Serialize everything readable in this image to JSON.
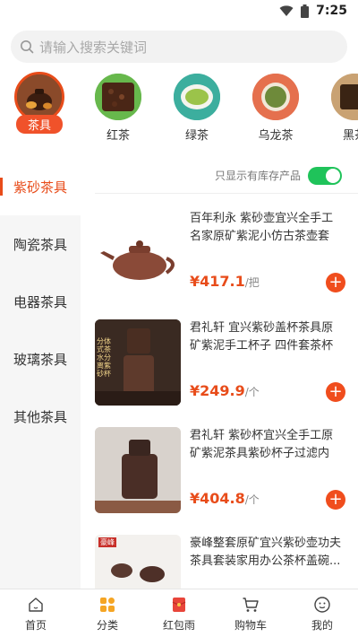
{
  "status_bar": {
    "time": "7:25"
  },
  "search": {
    "placeholder": "请输入搜索关键词"
  },
  "categories": [
    {
      "label": "茶具",
      "active": true
    },
    {
      "label": "红茶"
    },
    {
      "label": "绿茶"
    },
    {
      "label": "乌龙茶"
    },
    {
      "label": "黑茶"
    }
  ],
  "side_menu": [
    "紫砂茶具",
    "陶瓷茶具",
    "电器茶具",
    "玻璃茶具",
    "其他茶具"
  ],
  "stock_filter": {
    "label": "只显示有库存产品",
    "enabled": true
  },
  "products": [
    {
      "title": "百年利永 紫砂壶宜兴全手工名家原矿紫泥小仿古茶壶套装...",
      "price": "¥417.1",
      "unit": "/把",
      "img_text": ""
    },
    {
      "title": "君礼轩 宜兴紫砂盖杯茶具原矿紫泥手工杯子 四件套茶杯过...",
      "price": "¥249.9",
      "unit": "/个",
      "img_text": "分体式茶水分离紫砂杯"
    },
    {
      "title": "君礼轩 紫砂杯宜兴全手工原矿紫泥茶具紫砂杯子过滤内胆...",
      "price": "¥404.8",
      "unit": "/个",
      "img_text": ""
    },
    {
      "title": "豪峰整套原矿宜兴紫砂壶功夫茶具套装家用办公茶杯盖碗...",
      "price": "",
      "unit": "",
      "img_text": "豪峰"
    }
  ],
  "tab_bar": {
    "home": "首页",
    "category": "分类",
    "red_packet": "红包雨",
    "cart": "购物车",
    "mine": "我的"
  },
  "colors": {
    "accent": "#e84c1a",
    "toggle": "#1fc35a"
  }
}
